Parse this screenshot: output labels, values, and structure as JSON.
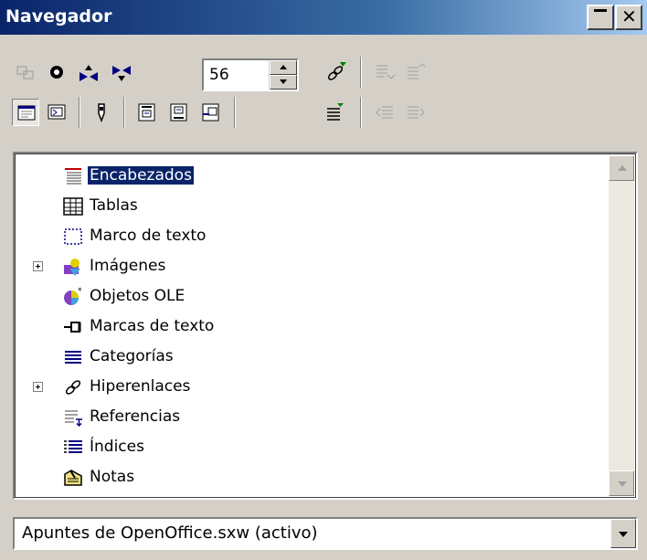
{
  "window": {
    "title": "Navegador"
  },
  "toolbar": {
    "page_number": "56"
  },
  "tree": {
    "items": [
      {
        "label": "Encabezados",
        "icon": "headings-icon",
        "expandable": false,
        "selected": true
      },
      {
        "label": "Tablas",
        "icon": "table-icon",
        "expandable": false,
        "selected": false
      },
      {
        "label": "Marco de texto",
        "icon": "text-frame-icon",
        "expandable": false,
        "selected": false
      },
      {
        "label": "Imágenes",
        "icon": "images-icon",
        "expandable": true,
        "selected": false
      },
      {
        "label": "Objetos OLE",
        "icon": "ole-object-icon",
        "expandable": false,
        "selected": false
      },
      {
        "label": "Marcas de texto",
        "icon": "bookmark-icon",
        "expandable": false,
        "selected": false
      },
      {
        "label": "Categorías",
        "icon": "categories-icon",
        "expandable": false,
        "selected": false
      },
      {
        "label": "Hiperenlaces",
        "icon": "hyperlink-icon",
        "expandable": true,
        "selected": false
      },
      {
        "label": "Referencias",
        "icon": "references-icon",
        "expandable": false,
        "selected": false
      },
      {
        "label": "Índices",
        "icon": "indexes-icon",
        "expandable": false,
        "selected": false
      },
      {
        "label": "Notas",
        "icon": "notes-icon",
        "expandable": false,
        "selected": false
      }
    ]
  },
  "document_selector": {
    "value": "Apuntes de OpenOffice.sxw (activo)"
  },
  "colors": {
    "title_bar": "#0a246a",
    "selection": "#0a246a",
    "face": "#d4d0c8"
  }
}
